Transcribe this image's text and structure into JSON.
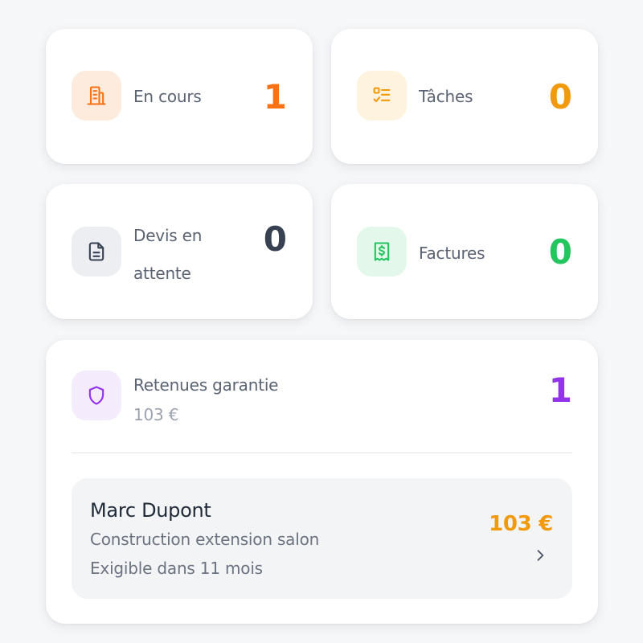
{
  "colors": {
    "orange": "#f97316",
    "amber": "#f29a0e",
    "slate": "#374151",
    "green": "#22c55e",
    "purple": "#9333ea"
  },
  "stats": {
    "en_cours": {
      "label": "En cours",
      "value": "1",
      "icon": "building-icon"
    },
    "taches": {
      "label": "Tâches",
      "value": "0",
      "icon": "checklist-icon"
    },
    "devis": {
      "label_line1": "Devis en",
      "label_line2": "attente",
      "value": "0",
      "icon": "document-icon"
    },
    "factures": {
      "label": "Factures",
      "value": "0",
      "icon": "receipt-dollar-icon"
    }
  },
  "retenues": {
    "label": "Retenues garantie",
    "total": "103 €",
    "count": "1",
    "icon": "shield-icon",
    "item": {
      "client": "Marc Dupont",
      "project": "Construction extension salon",
      "due": "Exigible dans 11 mois",
      "amount": "103 €",
      "icon": "chevron-right-icon"
    }
  }
}
